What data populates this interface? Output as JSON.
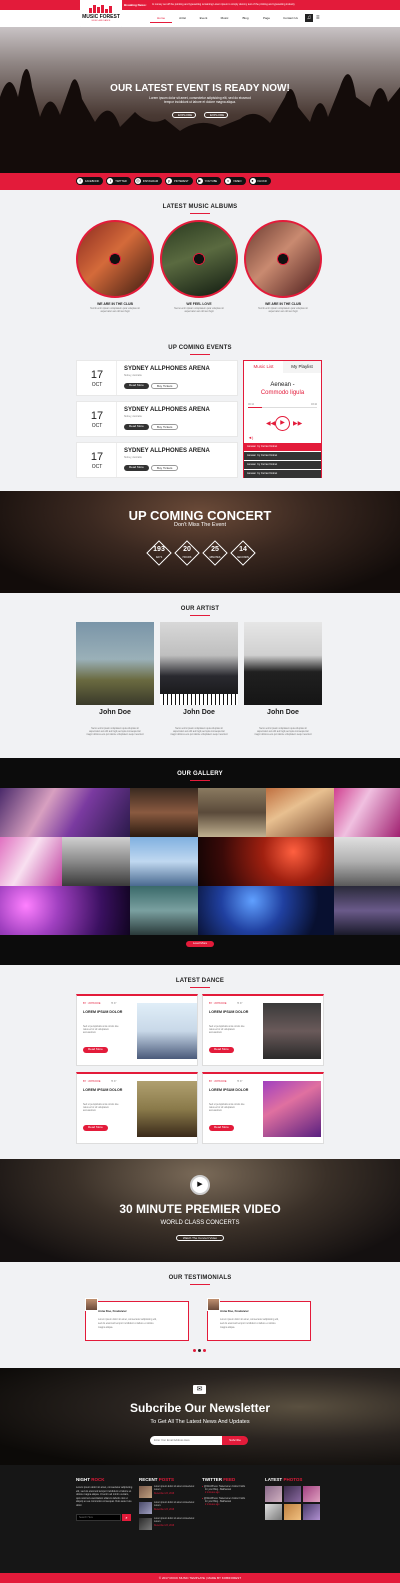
{
  "topbar": {
    "breaking_label": "Breaking News:",
    "ticker": "In nonary set off the pointing and typesetting remaining    Lorem ipsum is simply dummy text of the printing and typesetting industry"
  },
  "logo": {
    "line1": "MUSIC FOREST",
    "line2": "MUSIC AND DANCE"
  },
  "nav": [
    "Home",
    "Artist",
    "Event",
    "Music",
    "Blog",
    "Page",
    "Contact Us"
  ],
  "hero": {
    "title": "OUR LATEST EVENT IS READY NOW!",
    "sub1": "Lorem ipsum dolor sit amet, consectetur adipisicing elit, sed do eiusmod",
    "sub2": "tempor incididunt ut labore et dolore magna aliqua.",
    "btn1": "EXPLORE",
    "btn2": "EXPLORE"
  },
  "social": [
    "FACEBOOK",
    "TWITTER",
    "INSTAGRAM",
    "PINTEREST",
    "YOUTUBE",
    "VIMEO",
    "FLICKR"
  ],
  "albums": {
    "title": "LATEST MUSIC ALBUMS",
    "items": [
      {
        "name": "WE ARE IN THE CLUB",
        "desc1": "Numb enim ipsam voluptatem quia voluptas sit",
        "desc2": "aspernatur aut odit aut fugit",
        "cover": "FAR FROM THE MADDING CROWD"
      },
      {
        "name": "WE FEEL LOVE",
        "desc1": "Nemo enim ipsam voluptatem quia voluptas sit",
        "desc2": "aspernatur aut odit aut fugit",
        "cover": "INTO THE WOODS"
      },
      {
        "name": "WE ARE IN THE CLUB",
        "desc1": "Numb enim ipsam voluptatem quia voluptas sit",
        "desc2": "aspernatur aut odit aut fugit",
        "cover": "SOME KIND OF BEAUTIFUL"
      }
    ]
  },
  "events": {
    "title": "UP COMING EVENTS",
    "items": [
      {
        "day": "17",
        "month": "OCT",
        "name": "SYDNEY ALLPHONES ARENA",
        "meta": "Sidney, Australia",
        "btn1": "Read More",
        "btn2": "Buy Tickets"
      },
      {
        "day": "17",
        "month": "OCT",
        "name": "SYDNEY ALLPHONES ARENA",
        "meta": "Sidney, Australia",
        "btn1": "Read More",
        "btn2": "Buy Tickets"
      },
      {
        "day": "17",
        "month": "OCT",
        "name": "SYDNEY ALLPHONES ARENA",
        "meta": "Sidney, Australia",
        "btn1": "Read More",
        "btn2": "Buy Tickets"
      }
    ]
  },
  "player": {
    "tab1": "Music List",
    "tab2": "My Playlist",
    "song1": "Aenean -",
    "song2": "Commodo ligula",
    "t_start": "00:12",
    "t_end": "03:42",
    "tracks": [
      {
        "n": "Aenean",
        "a": "by Curran Dotnet"
      },
      {
        "n": "Aenean",
        "a": "by Curran Dotnet"
      },
      {
        "n": "Aenean",
        "a": "by Curran Dotnet"
      },
      {
        "n": "Aenean",
        "a": "by Curran Dotnet"
      }
    ]
  },
  "concert": {
    "title": "UP COMING CONCERT",
    "sub": "Don't Miss The Event",
    "counts": [
      {
        "v": "193",
        "l": "DAYS"
      },
      {
        "v": "20",
        "l": "HOURS"
      },
      {
        "v": "25",
        "l": "MINUTES"
      },
      {
        "v": "14",
        "l": "SECONDS"
      }
    ]
  },
  "artists": {
    "title": "OUR ARTIST",
    "items": [
      {
        "name": "John Doe",
        "d1": "Nemo enim ipsam voluptatem quia voluptas sit",
        "d2": "aspernatur aut odit aut fugit,sed quia consequuntur",
        "d3": "magni dolores eos qui ratione voluptatem sequi nesciunt"
      },
      {
        "name": "John Doe",
        "d1": "Nemo enim ipsam voluptatem quia voluptas sit",
        "d2": "aspernatur aut odit aut fugit,sed quia consequuntur",
        "d3": "magni dolores eos qui ratione voluptatem sequi nesciunt"
      },
      {
        "name": "John Doe",
        "d1": "Nemo enim ipsam voluptatem quia voluptas sit",
        "d2": "aspernatur aut odit aut fugit,sed quia consequuntur",
        "d3": "magni dolores eos qui ratione voluptatem sequi nesciunt"
      }
    ]
  },
  "gallery": {
    "title": "OUR GALLERY",
    "btn": "Load More"
  },
  "dance": {
    "title": "LATEST DANCE",
    "items": [
      {
        "by": "BY : JOHN DOE",
        "c": "⚑ 37",
        "h": "LOREM IPSUM DOLOR",
        "d1": "Sed ut perspiciatis unde omnis iste",
        "d2": "natus error sit voluptatem",
        "d3": "accusantium",
        "btn": "Read More"
      },
      {
        "by": "BY : JOHN DOE",
        "c": "⚑ 37",
        "h": "LOREM IPSUM DOLOR",
        "d1": "Sed ut perspiciatis unde omnis iste",
        "d2": "natus error sit voluptatem",
        "d3": "accusantium",
        "btn": "Read More"
      },
      {
        "by": "BY : JOHN DOE",
        "c": "⚑ 37",
        "h": "LOREM IPSUM DOLOR",
        "d1": "Sed ut perspiciatis unde omnis iste",
        "d2": "natus error sit voluptatem",
        "d3": "accusantium",
        "btn": "Read More"
      },
      {
        "by": "BY : JOHN DOE",
        "c": "⚑ 37",
        "h": "LOREM IPSUM DOLOR",
        "d1": "Sed ut perspiciatis unde omnis iste",
        "d2": "natus error sit voluptatem",
        "d3": "accusantium",
        "btn": "Read More"
      }
    ]
  },
  "video": {
    "title": "30 MINUTE PREMIER VIDEO",
    "sub": "WORLD CLASS CONCERTS",
    "btn": "Watch The Concert Video"
  },
  "testimonials": {
    "title": "OUR TESTIMONIALS",
    "items": [
      {
        "name": "Anna Doe, Freelancer",
        "d1": "Lorem ipsum dolor sit amet, consectetur adipisicing elit,",
        "d2": "sed do eiusmod tempor incididunt ut labore et dolore",
        "d3": "magna aliqua."
      },
      {
        "name": "Anna Doe, Freelancer",
        "d1": "Lorem ipsum dolor sit amet, consectetur adipisicing elit,",
        "d2": "sed do eiusmod tempor incididunt ut labore et dolore",
        "d3": "magna aliqua."
      }
    ]
  },
  "newsletter": {
    "title": "Subcribe Our Newsletter",
    "sub": "To Get All The Latest News And Updates",
    "placeholder": "Enter Your Email Address Here",
    "btn": "Subcribe"
  },
  "footer": {
    "col1": {
      "t1": "NIGHT",
      "t2": "ROCK",
      "d": "Lorem ipsum dolor sit amet, consectetur adipiscing elit, sed do eiusmod tempor incididunt ut labore et dolore magna aliqua. Ut enim ad minim veniam, quis nostrud exercitation ullamco laboris nisi ut aliquip ex ea commodo consequat. Duis aute irure dolor.",
      "placeholder": "Search Here"
    },
    "col2": {
      "t1": "RECENT",
      "t2": "POSTS",
      "items": [
        {
          "d": "Lorem ipsum dolor sit amet consectetur. Lorem.",
          "date": "December 23, 2016"
        },
        {
          "d": "Lorem ipsum dolor sit amet consectetur. Lorem.",
          "date": "December 23, 2016"
        },
        {
          "d": "Lorem ipsum dolor sit amet consectetur. Lorem.",
          "date": "December 23, 2016"
        }
      ]
    },
    "col3": {
      "t1": "TWITTER",
      "t2": "FEED",
      "items": [
        {
          "a": "@WordPress: Tastemonen Colour Folds",
          "b": "for your Blog - Badhansal",
          "c": "2 minutes ago"
        },
        {
          "a": "@WordPress: Tastemonen Colour Folds",
          "b": "for your Blog - Badhansal",
          "c": "2 minutes ago"
        }
      ]
    },
    "col4": {
      "t1": "LATEST",
      "t2": "PHOTOS"
    },
    "copyright": "© 2017 ROCK MUSIC TEMPLATE  |  MADE BY KOBIFOREST"
  },
  "colors": {
    "accent": "#e31b3a",
    "dark": "#161616"
  }
}
